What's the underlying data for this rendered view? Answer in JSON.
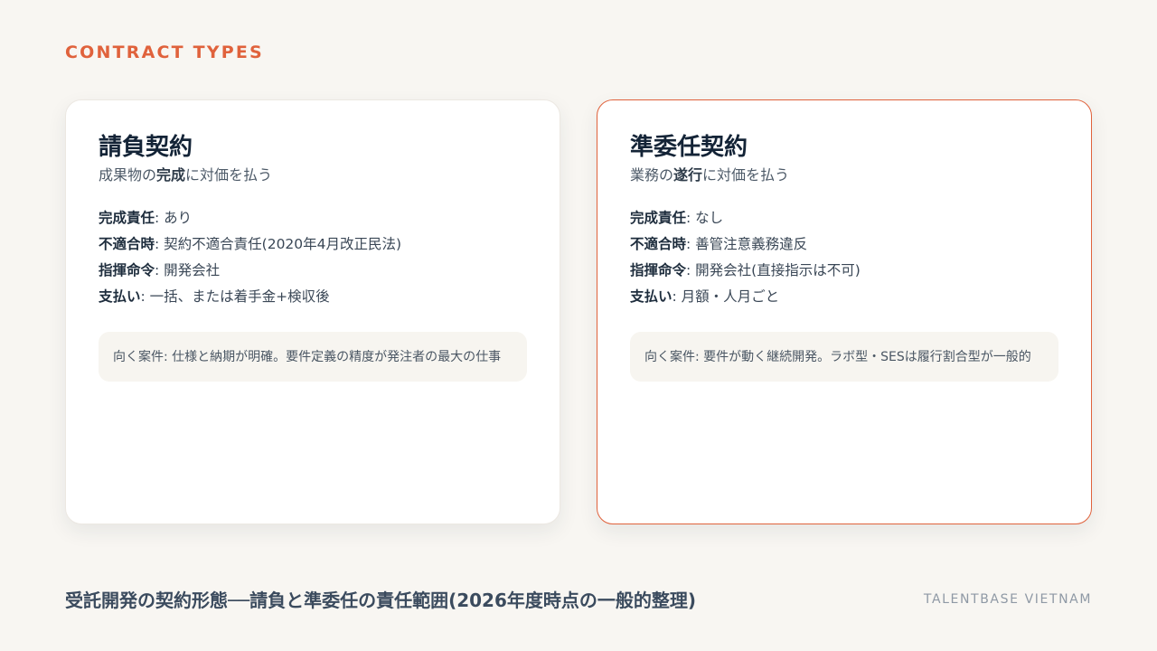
{
  "section_label": "CONTRACT TYPES",
  "cards": [
    {
      "title": "請負契約",
      "subtitle": {
        "pre": "成果物の",
        "bold": "完成",
        "post": "に対価を払う"
      },
      "rows": [
        {
          "key": "完成責任",
          "value": ": あり"
        },
        {
          "key": "不適合時",
          "value": ": 契約不適合責任(2020年4月改正民法)"
        },
        {
          "key": "指揮命令",
          "value": ": 開発会社"
        },
        {
          "key": "支払い",
          "value": ": 一括、または着手金+検収後"
        }
      ],
      "note": "向く案件: 仕様と納期が明確。要件定義の精度が発注者の最大の仕事"
    },
    {
      "title": "準委任契約",
      "subtitle": {
        "pre": "業務の",
        "bold": "遂行",
        "post": "に対価を払う"
      },
      "rows": [
        {
          "key": "完成責任",
          "value": ": なし"
        },
        {
          "key": "不適合時",
          "value": ": 善管注意義務違反"
        },
        {
          "key": "指揮命令",
          "value": ": 開発会社(直接指示は不可)"
        },
        {
          "key": "支払い",
          "value": ": 月額・人月ごと"
        }
      ],
      "note": "向く案件: 要件が動く継続開発。ラボ型・SESは履行割合型が一般的"
    }
  ],
  "footer": {
    "title": "受託開発の契約形態──請負と準委任の責任範囲(2026年度時点の一般的整理)",
    "brand": "TALENTBASE VIETNAM"
  },
  "colors": {
    "accent": "#e0623c",
    "background": "#f8f6f2",
    "card": "#ffffff",
    "note_background": "#f7f5f0",
    "title": "#142437"
  }
}
